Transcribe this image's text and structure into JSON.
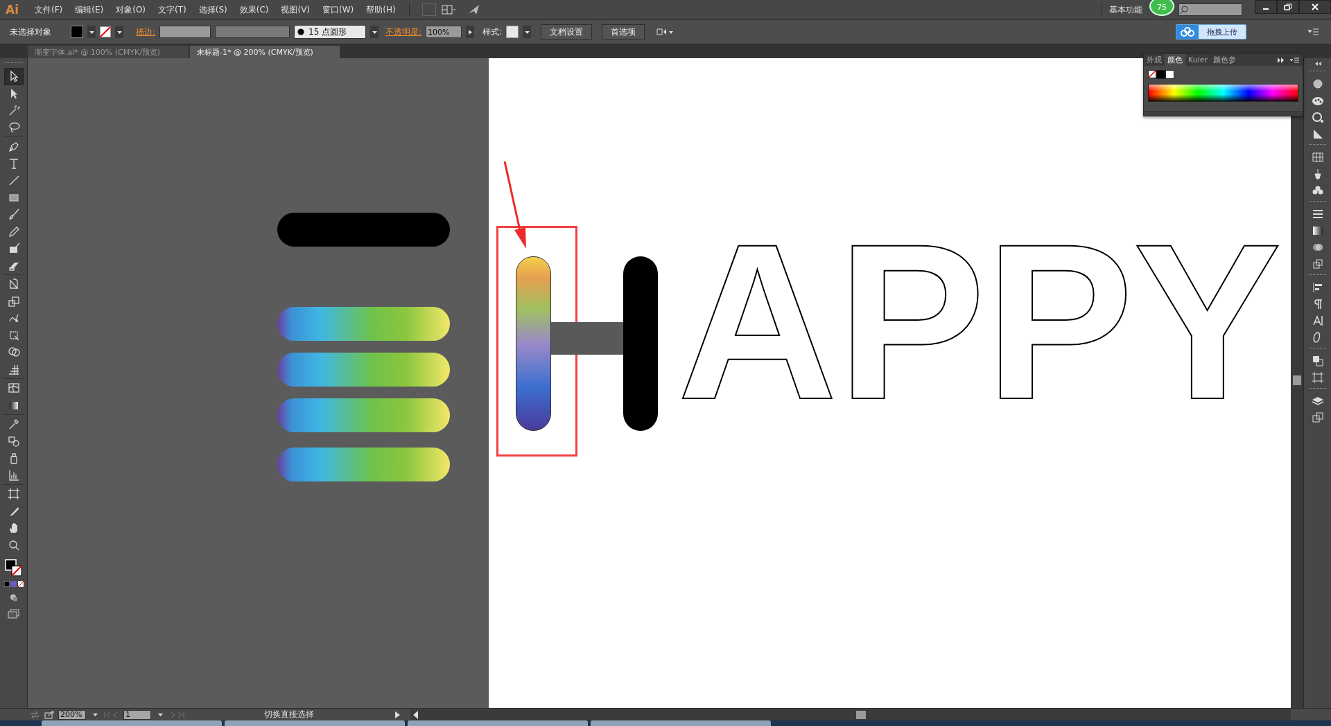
{
  "app": {
    "logo": "Ai"
  },
  "menu": [
    "文件(F)",
    "编辑(E)",
    "对象(O)",
    "文字(T)",
    "选择(S)",
    "效果(C)",
    "视图(V)",
    "窗口(W)",
    "帮助(H)"
  ],
  "workspace": {
    "label": "基本功能",
    "badge": "75",
    "upload_button": "拖拽上传"
  },
  "control_bar": {
    "selection": "未选择对象",
    "stroke_label": "描边:",
    "brush": "15 点圆形",
    "opacity_label": "不透明度:",
    "opacity": "100%",
    "style_label": "样式:",
    "buttons": [
      "文档设置",
      "首选项"
    ]
  },
  "doc_tabs": [
    {
      "label": "渐变字体.ai* @ 100% (CMYK/预览)",
      "selected": false
    },
    {
      "label": "未标题-1* @ 200% (CMYK/预览)",
      "selected": true
    }
  ],
  "tools": [
    {
      "kind": "select",
      "selected": true
    },
    {
      "kind": "direct",
      "selected": false
    },
    {
      "kind": "wand",
      "selected": false
    },
    {
      "kind": "lasso",
      "selected": false
    },
    {
      "kind": "pen",
      "selected": false
    },
    {
      "kind": "type",
      "selected": false
    },
    {
      "kind": "line",
      "selected": false
    },
    {
      "kind": "rect",
      "selected": false
    },
    {
      "kind": "brush",
      "selected": false
    },
    {
      "kind": "pencil",
      "selected": false
    },
    {
      "kind": "blob",
      "selected": false
    },
    {
      "kind": "eraser",
      "selected": false
    },
    {
      "kind": "rotate",
      "selected": false
    },
    {
      "kind": "scale",
      "selected": false
    },
    {
      "kind": "warp",
      "selected": false
    },
    {
      "kind": "freetransform",
      "selected": false
    },
    {
      "kind": "shapebuilder",
      "selected": false
    },
    {
      "kind": "perspective",
      "selected": false
    },
    {
      "kind": "mesh",
      "selected": false
    },
    {
      "kind": "gradient",
      "selected": false
    },
    {
      "kind": "eyedropper",
      "selected": false
    },
    {
      "kind": "blend",
      "selected": false
    },
    {
      "kind": "spray",
      "selected": false
    },
    {
      "kind": "graph",
      "selected": false
    },
    {
      "kind": "artboard",
      "selected": false
    },
    {
      "kind": "slice",
      "selected": false
    },
    {
      "kind": "hand",
      "selected": false
    },
    {
      "kind": "zoom",
      "selected": false
    }
  ],
  "color_panel": {
    "tabs": [
      {
        "label": "外观",
        "selected": false
      },
      {
        "label": "颜色",
        "selected": true
      },
      {
        "label": "Kuler",
        "selected": false
      },
      {
        "label": "颜色参",
        "selected": false
      }
    ]
  },
  "artboard": {
    "letters": "APPY"
  },
  "status_bar": {
    "zoom": "200%",
    "page": "1",
    "tool_hint": "切换直接选择"
  }
}
